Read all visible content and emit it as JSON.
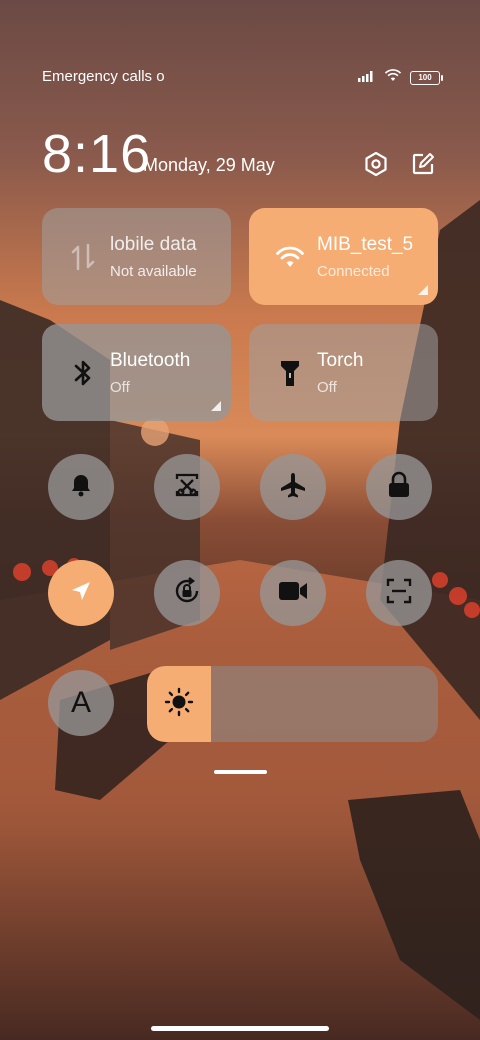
{
  "status_bar": {
    "carrier_text": "Emergency calls o",
    "battery_level": "100",
    "icons": [
      "signal-icon",
      "wifi-icon",
      "battery-icon"
    ]
  },
  "header": {
    "time": "8:16",
    "date": "Monday, 29 May",
    "icons": [
      "settings-icon",
      "edit-icon"
    ]
  },
  "tiles": {
    "mobile_data": {
      "title": "lobile data",
      "subtitle": "Not available",
      "state": "disabled",
      "icon": "mobile-data-icon"
    },
    "wifi": {
      "title": "MIB_test_5",
      "subtitle": "Connected",
      "state": "on",
      "icon": "wifi-icon"
    },
    "bluetooth": {
      "title": "Bluetooth",
      "subtitle": "Off",
      "state": "off",
      "icon": "bluetooth-icon"
    },
    "torch": {
      "title": "Torch",
      "subtitle": "Off",
      "state": "off",
      "icon": "torch-icon"
    }
  },
  "toggles": [
    {
      "icon": "bell-icon",
      "active": false
    },
    {
      "icon": "screenshot-icon",
      "active": false
    },
    {
      "icon": "airplane-icon",
      "active": false
    },
    {
      "icon": "lock-icon",
      "active": false
    },
    {
      "icon": "location-icon",
      "active": true
    },
    {
      "icon": "rotation-lock-icon",
      "active": false
    },
    {
      "icon": "video-camera-icon",
      "active": false
    },
    {
      "icon": "scanner-icon",
      "active": false
    },
    {
      "icon": "font-size-icon",
      "label": "A",
      "active": false
    }
  ],
  "brightness": {
    "level_fraction": 0.22,
    "icon": "brightness-icon"
  },
  "colors": {
    "accent": "#f5ad73",
    "tile_gray": "#969696"
  }
}
